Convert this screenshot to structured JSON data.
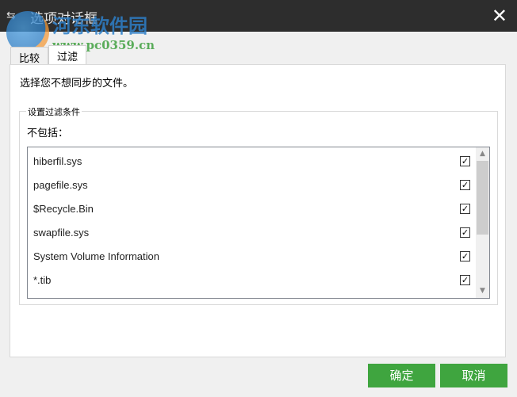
{
  "window": {
    "title": "选项对话框",
    "close": "✕"
  },
  "watermark": {
    "name": "河东软件园",
    "url": "www.pc0359.cn"
  },
  "tabs": [
    {
      "label": "比较"
    },
    {
      "label": "过滤"
    }
  ],
  "description": "选择您不想同步的文件。",
  "filter": {
    "group_label": "设置过滤条件",
    "exclude_label": "不包括：",
    "items": [
      {
        "name": "hiberfil.sys",
        "checked": true
      },
      {
        "name": "pagefile.sys",
        "checked": true
      },
      {
        "name": "$Recycle.Bin",
        "checked": true
      },
      {
        "name": "swapfile.sys",
        "checked": true
      },
      {
        "name": "System Volume Information",
        "checked": true
      },
      {
        "name": "*.tib",
        "checked": true
      }
    ]
  },
  "buttons": {
    "ok": "确定",
    "cancel": "取消"
  },
  "colors": {
    "titlebar": "#2d2d2d",
    "button": "#3fa53f"
  }
}
